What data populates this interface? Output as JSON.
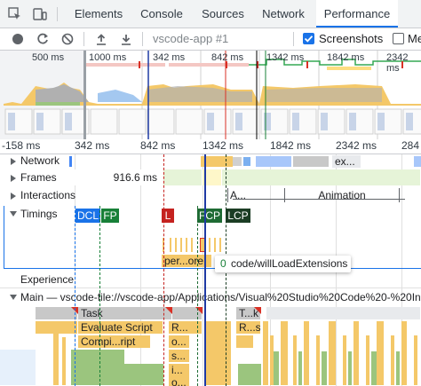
{
  "tabs": {
    "elements": "Elements",
    "console": "Console",
    "sources": "Sources",
    "network": "Network",
    "performance": "Performance"
  },
  "toolbar": {
    "profile_select": "vscode-app #1",
    "screenshots_label": "Screenshots",
    "screenshots_checked": true,
    "overflow_label": "Me"
  },
  "overview": {
    "ticks": [
      "500 ms",
      "1000 ms",
      "342 ms",
      "842 ms",
      "1342 ms",
      "1842 ms",
      "2342 ms"
    ]
  },
  "ruler": {
    "ticks": [
      "-158 ms",
      "342 ms",
      "842 ms",
      "1342 ms",
      "1842 ms",
      "2342 ms",
      "284"
    ]
  },
  "tracks": {
    "network": "Network",
    "frames": "Frames",
    "frames_duration": "916.6 ms",
    "interactions": "Interactions",
    "timings": "Timings",
    "experience": "Experience",
    "main": "Main — vscode-file://vscode-app/Applications/Visual%20Studio%20Code%20-%20In"
  },
  "network_requests": {
    "ex": "ex..."
  },
  "interactions": {
    "a": "A...",
    "animation": "Animation"
  },
  "timing_markers": {
    "dcl": "DCL",
    "fp": "FP",
    "l": "L",
    "fcp": "FCP",
    "lcp": "LCP",
    "per": "per...ore"
  },
  "tooltip": {
    "duration": "0",
    "name": "code/willLoadExtensions"
  },
  "flame": {
    "task": "Task",
    "task_k": "T...k",
    "evaluate": "Evaluate Script",
    "r1": "R...",
    "r2": "R...s",
    "compile": "Compi...ript",
    "o1": "o...",
    "o2": "o...",
    "s": "s...",
    "i": "i..."
  },
  "colors": {
    "accent": "#1a73e8",
    "dcl": "#1a73e8",
    "fp": "#188038",
    "l": "#c5221f",
    "fcp": "#1e6b34",
    "lcp": "#1b3d24",
    "scripting": "#f4c869",
    "task": "#c8c8c8",
    "cursor": "#1f3aa4"
  }
}
